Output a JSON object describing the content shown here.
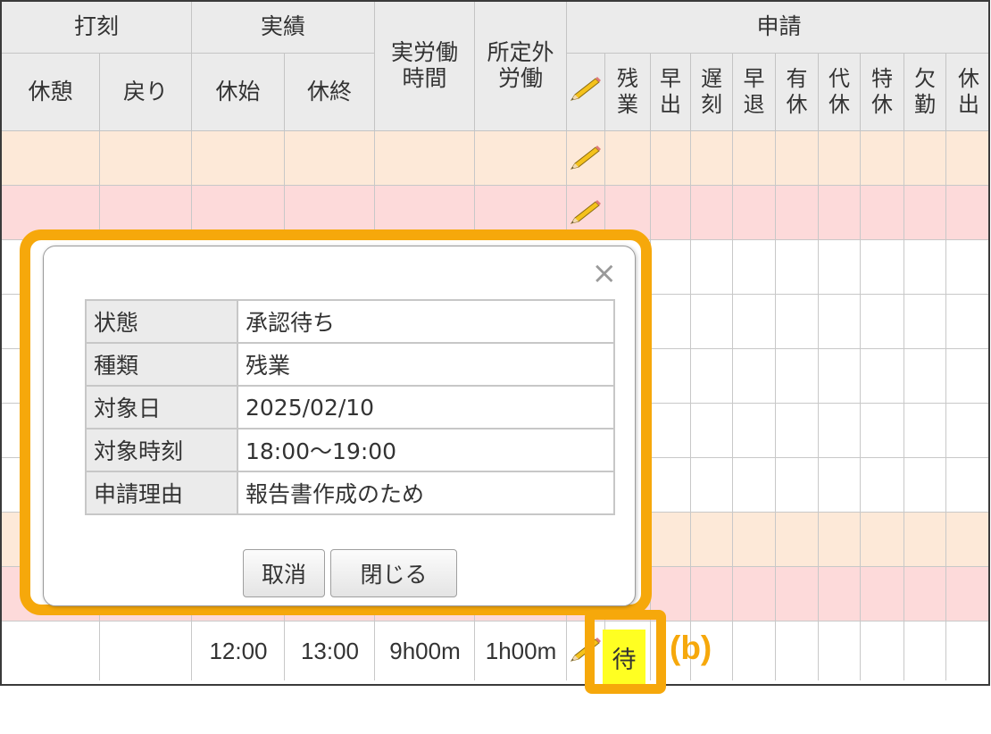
{
  "header": {
    "group_punch": "打刻",
    "group_actual": "実績",
    "group_request": "申請",
    "actual_work_hours": "実労働\n時間",
    "non_scheduled_work": "所定外\n労働",
    "col_break": "休憩",
    "col_return": "戻り",
    "col_break_start": "休始",
    "col_break_end": "休終",
    "request_types": [
      "残業",
      "早出",
      "遅刻",
      "早退",
      "有休",
      "代休",
      "特休",
      "欠勤",
      "休出"
    ]
  },
  "rows": [
    {
      "style": "peach"
    },
    {
      "style": "pink"
    },
    {
      "style": "white"
    },
    {
      "style": "white"
    },
    {
      "style": "white"
    },
    {
      "style": "white"
    },
    {
      "style": "white"
    },
    {
      "style": "peach"
    },
    {
      "style": "pink"
    }
  ],
  "last_row": {
    "break_start": "12:00",
    "break_end": "13:00",
    "actual_hours": "9h00m",
    "overtime": "1h00m",
    "status_badge": "待"
  },
  "dialog": {
    "close_glyph": "×",
    "fields": [
      {
        "label": "状態",
        "value": "承認待ち"
      },
      {
        "label": "種類",
        "value": "残業"
      },
      {
        "label": "対象日",
        "value": "2025/02/10"
      },
      {
        "label": "対象時刻",
        "value": "18:00〜19:00"
      },
      {
        "label": "申請理由",
        "value": "報告書作成のため"
      }
    ],
    "cancel_button": "取消",
    "close_button": "閉じる"
  },
  "annotation": {
    "label": "(b)"
  },
  "colors": {
    "highlight": "#f6a80b",
    "peach_row": "#fde9d8",
    "pink_row": "#fddada",
    "status_yellow": "#ffff22",
    "header_bg": "#ebebeb"
  },
  "icons": {
    "edit": "pencil-icon"
  }
}
